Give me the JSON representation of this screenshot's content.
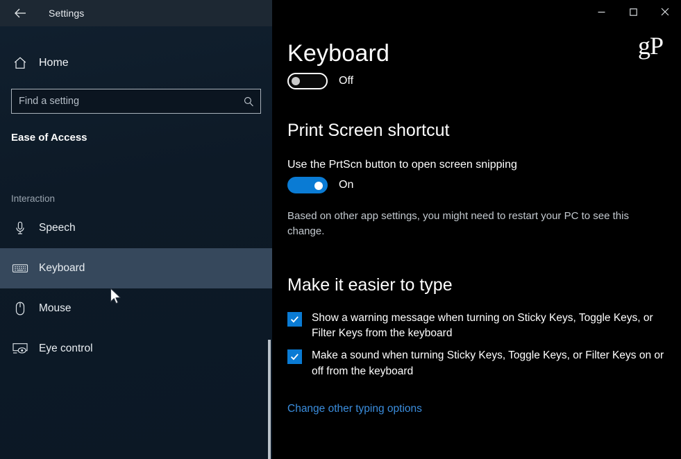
{
  "window": {
    "title": "Settings",
    "back_icon": "back-arrow-icon",
    "minimize_label": "–",
    "maximize_label": "□",
    "close_label": "✕"
  },
  "sidebar": {
    "home": {
      "label": "Home",
      "icon": "home-icon"
    },
    "search": {
      "placeholder": "Find a setting",
      "value": "",
      "icon": "search-icon"
    },
    "section_title": "Ease of Access",
    "group_title": "Interaction",
    "items": [
      {
        "label": "Speech",
        "icon": "microphone-icon",
        "selected": false
      },
      {
        "label": "Keyboard",
        "icon": "keyboard-icon",
        "selected": true
      },
      {
        "label": "Mouse",
        "icon": "mouse-icon",
        "selected": false
      },
      {
        "label": "Eye control",
        "icon": "eye-control-icon",
        "selected": false
      }
    ]
  },
  "main": {
    "watermark": "gP",
    "page_title": "Keyboard",
    "master_toggle": {
      "state_label": "Off",
      "on": false
    },
    "print_screen": {
      "heading": "Print Screen shortcut",
      "setting_label": "Use the PrtScn button to open screen snipping",
      "toggle": {
        "state_label": "On",
        "on": true
      },
      "help_text": "Based on other app settings, you might need to restart your PC to see this change."
    },
    "easier_to_type": {
      "heading": "Make it easier to type",
      "checkboxes": [
        {
          "label": "Show a warning message when turning on Sticky Keys, Toggle Keys, or Filter Keys from the keyboard",
          "checked": true
        },
        {
          "label": "Make a sound when turning Sticky Keys, Toggle Keys, or Filter Keys on or off from the keyboard",
          "checked": true
        }
      ],
      "link": "Change other typing options"
    }
  },
  "colors": {
    "accent": "#0a7bd4",
    "link": "#3b8ede",
    "selected_row": "#36485c",
    "sidebar_bg": "#0d1a27",
    "main_bg": "#000000"
  }
}
